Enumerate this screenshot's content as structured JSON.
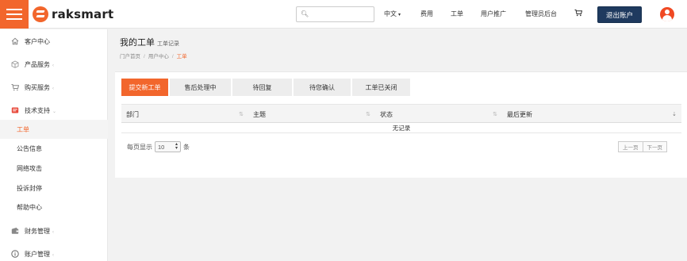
{
  "brand": {
    "name": "raksmart",
    "accent": "#f2662c"
  },
  "header": {
    "search_placeholder": "",
    "nav": [
      {
        "label": "中文",
        "dropdown": true
      },
      {
        "label": "费用"
      },
      {
        "label": "工单"
      },
      {
        "label": "用户推广"
      },
      {
        "label": "管理员后台"
      }
    ],
    "cart_icon": "cart-icon",
    "logout_label": "退出账户",
    "avatar_icon": "user-icon"
  },
  "sidebar": {
    "items": [
      {
        "label": "客户中心",
        "icon": "home-icon"
      },
      {
        "label": "产品服务",
        "icon": "cube-icon",
        "arrow": "‹"
      },
      {
        "label": "购买服务",
        "icon": "cart-icon",
        "arrow": "‹"
      },
      {
        "label": "技术支持",
        "icon": "support-icon",
        "arrow": "⌄"
      },
      {
        "label": "财务管理",
        "icon": "wallet-icon",
        "arrow": "‹"
      },
      {
        "label": "账户管理",
        "icon": "info-icon",
        "arrow": "‹"
      }
    ],
    "sub_items": [
      {
        "label": "工单",
        "active": true
      },
      {
        "label": "公告信息"
      },
      {
        "label": "网络攻击"
      },
      {
        "label": "投诉封停"
      },
      {
        "label": "帮助中心"
      }
    ]
  },
  "page": {
    "title": "我的工单",
    "subtitle": "工单记录",
    "breadcrumb": [
      "门户首页",
      "用户中心",
      "工单"
    ]
  },
  "tabs": [
    {
      "label": "提交新工单",
      "active": true
    },
    {
      "label": "售后处理中"
    },
    {
      "label": "待回复"
    },
    {
      "label": "待您确认"
    },
    {
      "label": "工单已关闭"
    }
  ],
  "table": {
    "columns": [
      "部门",
      "主题",
      "状态",
      "最后更新"
    ],
    "empty_text": "无记录"
  },
  "pager": {
    "prefix": "每页显示",
    "page_size": "10",
    "suffix": "条",
    "prev": "上一页",
    "next": "下一页"
  }
}
